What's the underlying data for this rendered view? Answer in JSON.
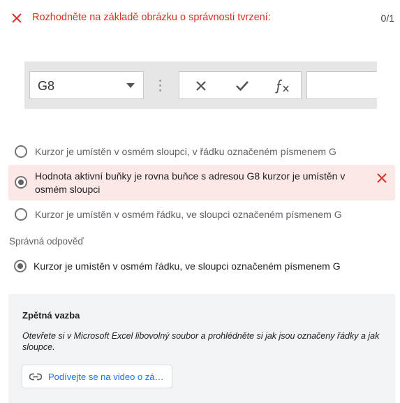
{
  "header": {
    "question": "Rozhodněte na základě obrázku o správnosti tvrzení:",
    "score": "0/1"
  },
  "image": {
    "name_box_value": "G8"
  },
  "options": [
    {
      "label": "Kurzor je umístěn v osmém sloupci, v řádku označeném písmenem G",
      "selected": false
    },
    {
      "label": "Hodnota aktivní buňky je rovna buňce s adresou G8 kurzor je umístěn v osmém sloupci",
      "selected": true,
      "status": "incorrect"
    },
    {
      "label": "Kurzor je umístěn v osmém řádku, ve sloupci označeném písmenem G",
      "selected": false
    }
  ],
  "correct_answer": {
    "heading": "Správná odpověď",
    "label": "Kurzor je umístěn v osmém řádku, ve sloupci označeném písmenem G"
  },
  "feedback": {
    "title": "Zpětná vazba",
    "text": "Otevřete si v Microsoft Excel libovolný soubor a prohlédněte si jak jsou označeny řádky a jak sloupce.",
    "link_label": "Podívejte se na video o zá…"
  },
  "colors": {
    "error_red": "#d93025",
    "incorrect_bg": "#fce8e6",
    "link_blue": "#1a73e8",
    "feedback_bg": "#f1f3f4"
  },
  "icons": [
    "close-icon",
    "dropdown-caret-icon",
    "cancel-x-icon",
    "checkmark-icon",
    "function-fx-icon",
    "wrong-icon",
    "link-icon"
  ]
}
